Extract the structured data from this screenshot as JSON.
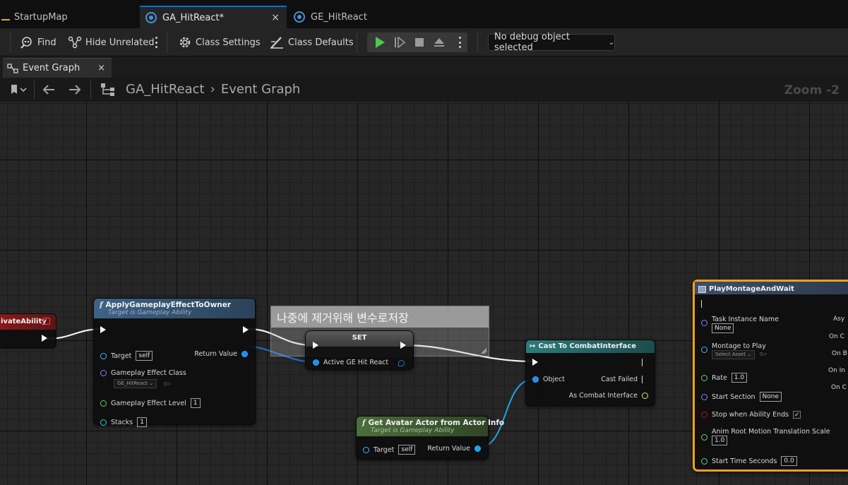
{
  "tabs": {
    "startup": "StartupMap",
    "ga": "GA_HitReact*",
    "ge": "GE_HitReact",
    "close": "×"
  },
  "toolbar": {
    "find": "Find",
    "hide_unrelated": "Hide Unrelated",
    "class_settings": "Class Settings",
    "class_defaults": "Class Defaults",
    "debug_object": "No debug object selected"
  },
  "graph_tab": {
    "label": "Event Graph",
    "close": "×"
  },
  "breadcrumb": {
    "root": "GA_HitReact",
    "sep": "›",
    "leaf": "Event Graph"
  },
  "zoom": "Zoom -2",
  "comment": "나중에 제거위해 변수로저장",
  "activate_stub": {
    "title": "ivateAbility"
  },
  "apply_node": {
    "title": "ApplyGameplayEffectToOwner",
    "subtitle": "Target is Gameplay Ability",
    "target_label": "Target",
    "target_value": "self",
    "effect_class_label": "Gameplay Effect Class",
    "effect_class_value": "GE_HitReact",
    "level_label": "Gameplay Effect Level",
    "level_value": "1",
    "stacks_label": "Stacks",
    "stacks_value": "1",
    "return_label": "Return Value"
  },
  "set_node": {
    "title": "SET",
    "var_label": "Active GE Hit React"
  },
  "cast_node": {
    "title": "Cast To CombatInterface",
    "object_label": "Object",
    "failed_label": "Cast Failed",
    "as_label": "As Combat Interface"
  },
  "avatar_node": {
    "title": "Get Avatar Actor from Actor Info",
    "subtitle": "Target is Gameplay Ability",
    "target_label": "Target",
    "target_value": "self",
    "return_label": "Return Value"
  },
  "montage_node": {
    "title": "PlayMontageAndWait",
    "task_label": "Task Instance Name",
    "task_value": "None",
    "montage_label": "Montage to Play",
    "montage_value": "Select Asset",
    "rate_label": "Rate",
    "rate_value": "1.0",
    "start_section_label": "Start Section",
    "start_section_value": "None",
    "stop_label": "Stop when Ability Ends",
    "root_motion_label": "Anim Root Motion Translation Scale",
    "root_motion_value": "1.0",
    "start_time_label": "Start Time Seconds",
    "start_time_value": "0.0",
    "out_async": "Asy",
    "out_1": "On C",
    "out_2": "On B",
    "out_3": "On In",
    "out_4": "On C"
  },
  "colors": {
    "accent_tab": "#0070e0",
    "function_header": "#3a5a78",
    "pure_header": "#4a6a3a",
    "cast_header": "#2a6f6f",
    "set_header": "#4a4a4a",
    "selected_border": "#f0a020",
    "object_pin": "#46b4ff"
  }
}
